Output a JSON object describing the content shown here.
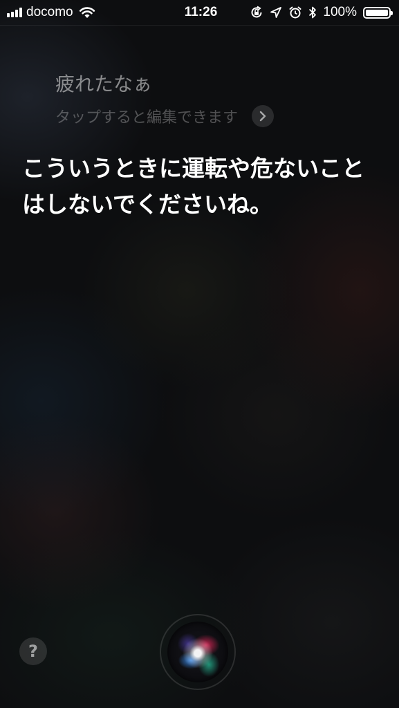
{
  "status_bar": {
    "carrier": "docomo",
    "time": "11:26",
    "battery_percent": "100%",
    "battery_level": 1.0,
    "signal_bars": 4,
    "icons": [
      "signal-icon",
      "wifi-icon",
      "orientation-lock-icon",
      "location-arrow-icon",
      "alarm-icon",
      "bluetooth-icon",
      "battery-icon"
    ]
  },
  "siri": {
    "user_query": "疲れたなぁ",
    "edit_hint": "タップすると編集できます",
    "response_line1": "こういうときに運転や危ないこと",
    "response_line2": "はしないでくださいね。",
    "help_label": "?"
  },
  "colors": {
    "background": "#0d0e10",
    "text_primary": "#ffffff"
  }
}
